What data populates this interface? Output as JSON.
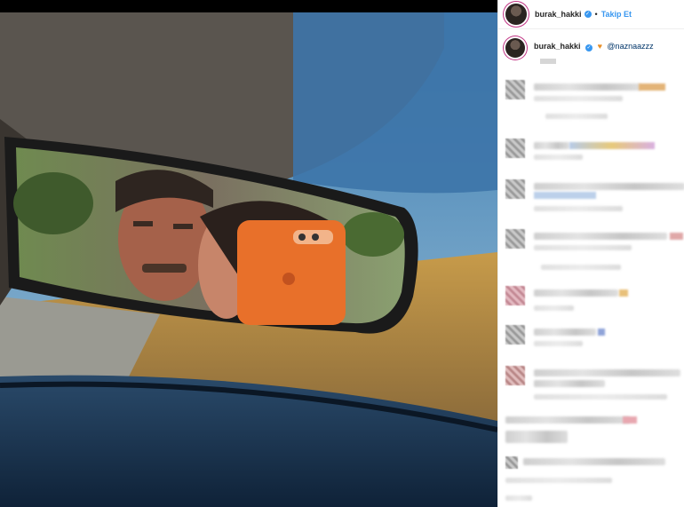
{
  "post": {
    "username": "burak_hakki",
    "follow_label": "Takip Et",
    "separator": "•",
    "caption_mention": "@naznaazzz",
    "colors": {
      "link": "#3897f0",
      "verified": "#3897f0",
      "heart": "#e8902a"
    }
  },
  "icons": {
    "verified": "verified-badge-icon",
    "heart": "heart-emoji-icon"
  },
  "comments_blurred": true
}
